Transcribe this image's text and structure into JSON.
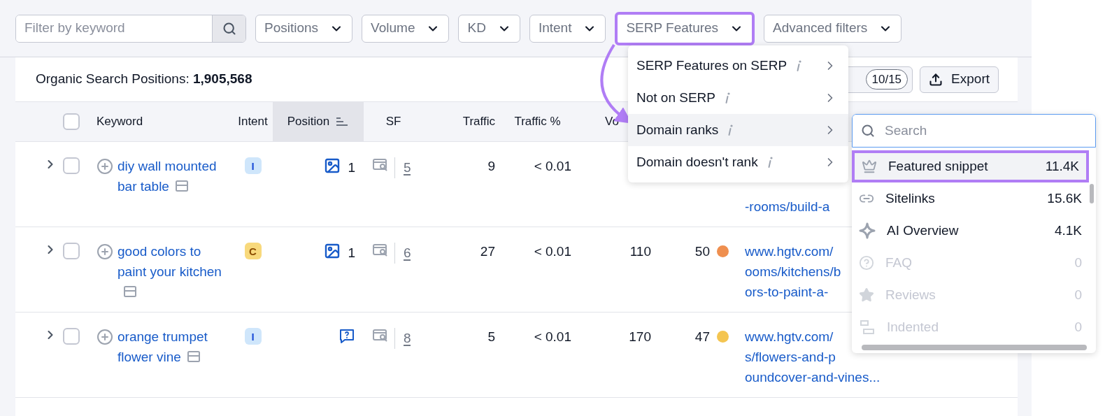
{
  "filters": {
    "search": {
      "placeholder": "Filter by keyword"
    },
    "buttons": [
      {
        "label": "Positions",
        "selected": false
      },
      {
        "label": "Volume",
        "selected": false
      },
      {
        "label": "KD",
        "selected": false
      },
      {
        "label": "Intent",
        "selected": false
      },
      {
        "label": "SERP Features",
        "selected": true
      },
      {
        "label": "Advanced filters",
        "selected": false
      }
    ]
  },
  "summary": {
    "label": "Organic Search Positions:",
    "count": "1,905,568",
    "columns_count": "10/15",
    "export": "Export"
  },
  "table": {
    "select_all_checked": false,
    "columns": [
      {
        "label": "Keyword",
        "selected": false
      },
      {
        "label": "Intent",
        "selected": false
      },
      {
        "label": "Position",
        "selected": true
      },
      {
        "label": "SF",
        "selected": false
      },
      {
        "label": "Traffic",
        "selected": false
      },
      {
        "label": "Traffic %",
        "selected": false
      },
      {
        "label": "Vo",
        "selected": false
      }
    ],
    "rows": [
      {
        "keyword": "diy wall mounted bar table",
        "checked": false,
        "intent": {
          "label": "I",
          "color": "#cfe6fb"
        },
        "position": {
          "kind": "image",
          "value": "1"
        },
        "sf": "5",
        "traffic": "9",
        "traffic_pct": "< 0.01",
        "url_lines": [
          "-rooms/build-a"
        ]
      },
      {
        "keyword": "good colors to paint your kitchen",
        "checked": false,
        "intent": {
          "label": "C",
          "color": "#f8d97c"
        },
        "position": {
          "kind": "image",
          "value": "1"
        },
        "sf": "6",
        "traffic": "27",
        "traffic_pct": "< 0.01",
        "volume": "110",
        "kd": {
          "value": "50",
          "color": "#ef8f4f"
        },
        "url_lines": [
          "www.hgtv.com/",
          "ooms/kitchens/b",
          "ors-to-paint-a-"
        ]
      },
      {
        "keyword": "orange trumpet flower vine",
        "checked": false,
        "intent": {
          "label": "I",
          "color": "#cfe6fb"
        },
        "position": {
          "kind": "faq"
        },
        "sf": "8",
        "traffic": "5",
        "traffic_pct": "< 0.01",
        "volume": "170",
        "kd": {
          "value": "47",
          "color": "#f4c551"
        },
        "url_lines": [
          "www.hgtv.com/",
          "s/flowers-and-p",
          "oundcover-and-vines..."
        ]
      }
    ]
  },
  "menu": {
    "items": [
      {
        "label": "SERP Features on SERP",
        "selected": false
      },
      {
        "label": "Not on SERP",
        "selected": false
      },
      {
        "label": "Domain ranks",
        "selected": true
      },
      {
        "label": "Domain doesn't rank",
        "selected": false
      }
    ]
  },
  "submenu": {
    "search": {
      "placeholder": "Search"
    },
    "items": [
      {
        "label": "Featured snippet",
        "count": "11.4K",
        "selected": true,
        "disabled": false
      },
      {
        "label": "Sitelinks",
        "count": "15.6K",
        "selected": false,
        "disabled": false
      },
      {
        "label": "AI Overview",
        "count": "4.1K",
        "selected": false,
        "disabled": false
      },
      {
        "label": "FAQ",
        "count": "0",
        "selected": false,
        "disabled": true
      },
      {
        "label": "Reviews",
        "count": "0",
        "selected": false,
        "disabled": true
      },
      {
        "label": "Indented",
        "count": "0",
        "selected": false,
        "disabled": true
      }
    ]
  }
}
